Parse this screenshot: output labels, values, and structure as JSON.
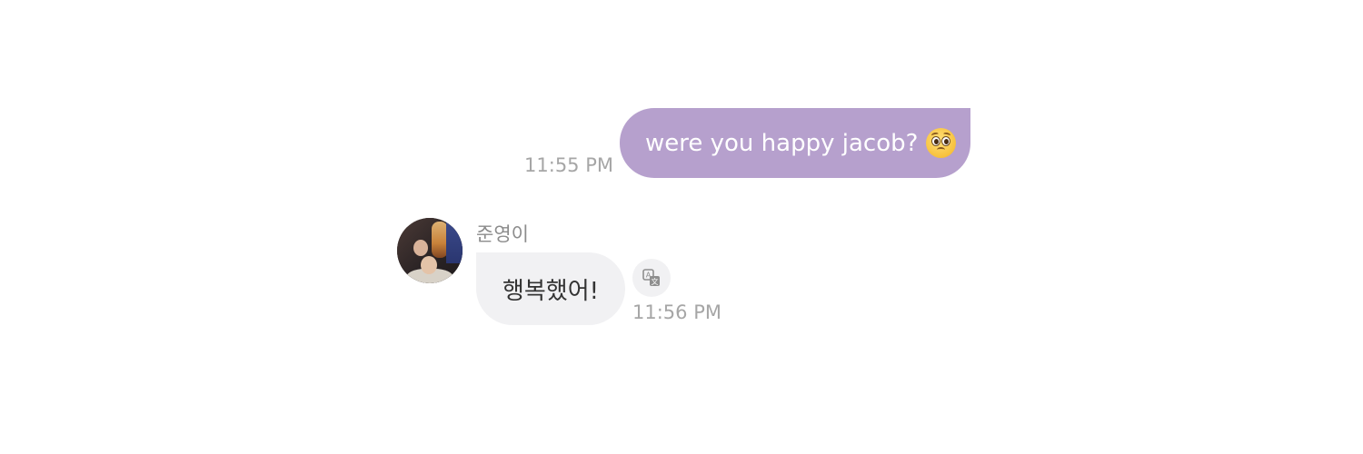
{
  "chat": {
    "messages": [
      {
        "direction": "outgoing",
        "text": "were you happy jacob?",
        "emoji": "pleading-face",
        "time": "11:55 PM",
        "bubble_color": "#b6a0cd"
      },
      {
        "direction": "incoming",
        "sender": "준영이",
        "text": "행복했어!",
        "time": "11:56 PM",
        "bubble_color": "#f1f1f3",
        "avatar": "avatar-photo",
        "action_icon": "translate-icon"
      }
    ]
  },
  "colors": {
    "timestamp": "#a6a6a6",
    "sender_name": "#8c8c8c",
    "background": "#ffffff"
  }
}
